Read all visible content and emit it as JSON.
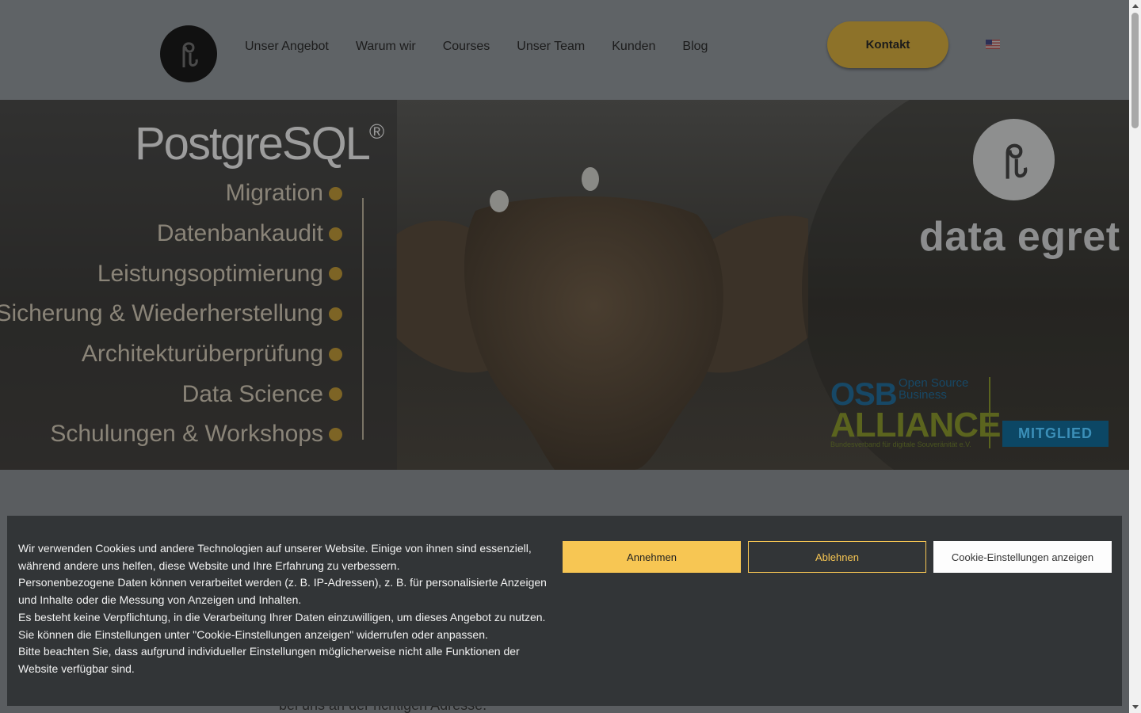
{
  "header": {
    "logo_alt": "data egret",
    "nav": [
      "Unser Angebot",
      "Warum wir",
      "Courses",
      "Unser Team",
      "Kunden",
      "Blog"
    ],
    "contact_label": "Kontakt",
    "language": "en-US"
  },
  "hero": {
    "postgres_title": "PostgreSQL",
    "postgres_mark": "®",
    "services": [
      "Migration",
      "Datenbankaudit",
      "Leistungsoptimierung",
      "Sicherung & Wiederherstellung",
      "Architekturüberprüfung",
      "Data Science",
      "Schulungen & Workshops"
    ],
    "brand_name": "data egret",
    "osb": {
      "big": "OSB",
      "small_1": "Open Source",
      "small_2": "Business",
      "alliance": "ALLIANCE",
      "sub": "Bundesverband für digitale Souveränität e.V.",
      "badge": "MITGLIED"
    }
  },
  "content": {
    "peek_text": "bei uns an der richtigen Adresse."
  },
  "cookie_banner": {
    "paragraphs": [
      "Wir verwenden Cookies und andere Technologien auf unserer Website. Einige von ihnen sind essenziell, während andere uns helfen, diese Website und Ihre Erfahrung zu verbessern.",
      "Personenbezogene Daten können verarbeitet werden (z. B. IP-Adressen), z. B. für personalisierte Anzeigen und Inhalte oder die Messung von Anzeigen und Inhalten.",
      "Es besteht keine Verpflichtung, in die Verarbeitung Ihrer Daten einzuwilligen, um dieses Angebot zu nutzen. Sie können die Einstellungen unter \"Cookie-Einstellungen anzeigen\" widerrufen oder anpassen.",
      "Bitte beachten Sie, dass aufgrund individueller Einstellungen möglicherweise nicht alle Funktionen der Website verfügbar sind."
    ],
    "accept_label": "Annehmen",
    "decline_label": "Ablehnen",
    "settings_label": "Cookie-Einstellungen anzeigen"
  },
  "colors": {
    "accent": "#f7c653",
    "banner_bg": "#323537",
    "overlay_header": "#5f6366"
  }
}
